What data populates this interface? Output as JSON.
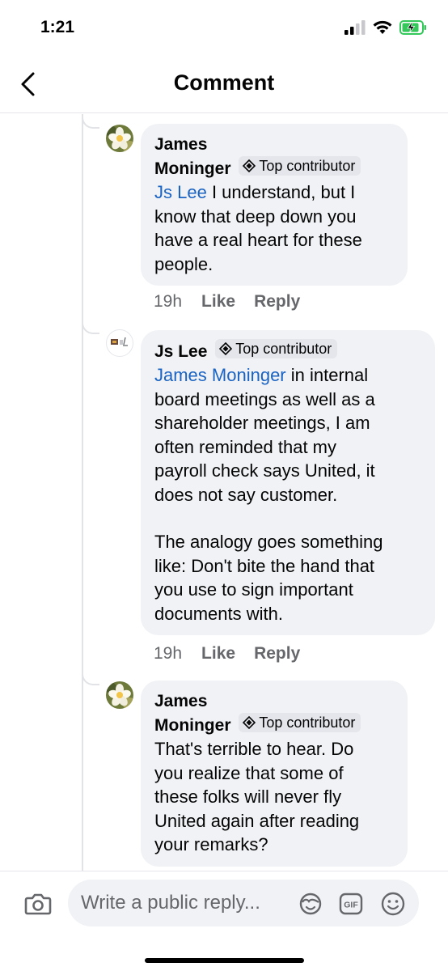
{
  "status_bar": {
    "time": "1:21"
  },
  "header": {
    "title": "Comment"
  },
  "comments": [
    {
      "author": "James Moninger",
      "author_line1": "James",
      "author_line2": "Moninger",
      "badge": "Top contributor",
      "mention": "Js Lee",
      "lines": [
        "I understand, but I",
        "know that deep down you",
        "have a real heart for these",
        "people."
      ],
      "time": "19h",
      "like": "Like",
      "reply": "Reply"
    },
    {
      "author": "Js Lee",
      "badge": "Top contributor",
      "mention": "James Moninger",
      "lines": [
        "in internal",
        "board meetings as well as a",
        "shareholder meetings, I am",
        "often reminded that my",
        "payroll check says United, it",
        "does not say customer."
      ],
      "lines2": [
        "The analogy goes something",
        "like: Don't bite the hand that",
        "you use to sign important",
        "documents with."
      ],
      "time": "19h",
      "like": "Like",
      "reply": "Reply"
    },
    {
      "author_line1": "James",
      "author_line2": "Moninger",
      "badge": "Top contributor",
      "lines": [
        "That's terrible to hear.  Do",
        "you realize that some of",
        "these folks will never fly",
        "United again after reading",
        "your remarks?"
      ]
    }
  ],
  "composer": {
    "placeholder": "Write a public reply...",
    "gif_label": "GIF"
  },
  "icons": {
    "back": "chevron-left-icon",
    "camera": "camera-icon",
    "avatar_sticker": "sticker-icon",
    "gif": "gif-icon",
    "emoji": "emoji-icon",
    "badge": "diamond-badge-icon"
  },
  "colors": {
    "mention": "#1a63c2",
    "bubble": "#f0f2f5",
    "secondary_text": "#65676b",
    "battery_charging": "#34c759"
  }
}
